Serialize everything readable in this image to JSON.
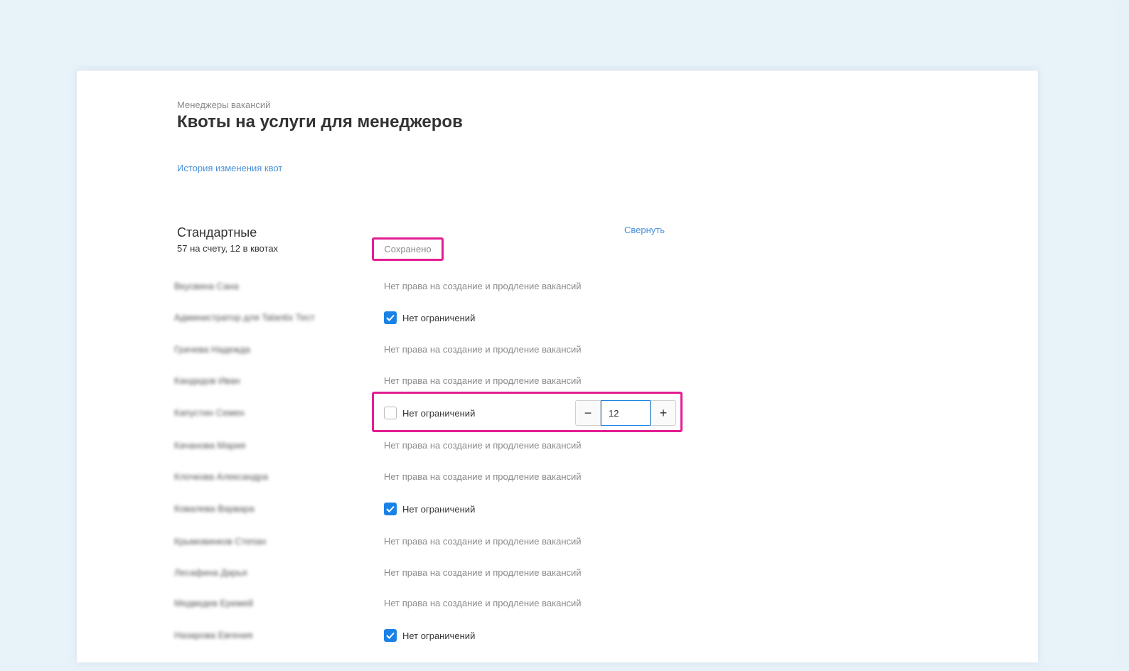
{
  "header": {
    "breadcrumb": "Менеджеры вакансий",
    "title": "Квоты на услуги для менеджеров",
    "history_link": "История изменения квот"
  },
  "section": {
    "title": "Стандартные",
    "subtitle": "57 на счету, 12 в квотах",
    "saved_status": "Сохранено",
    "collapse_label": "Свернуть"
  },
  "labels": {
    "no_rights": "Нет права на создание и продление вакансий",
    "unlimited": "Нет ограничений"
  },
  "managers": [
    {
      "name": "Вкусвина Сана",
      "state": "no_rights"
    },
    {
      "name": "Администратор для Talantix Тест",
      "state": "unlimited"
    },
    {
      "name": "Грачева Надежда",
      "state": "no_rights"
    },
    {
      "name": "Кандидов Иван",
      "state": "no_rights"
    },
    {
      "name": "Капустин Семен",
      "state": "limited",
      "quota": "12"
    },
    {
      "name": "Качанова Мария",
      "state": "no_rights"
    },
    {
      "name": "Клочкова Александра",
      "state": "no_rights"
    },
    {
      "name": "Ковалева Варвара",
      "state": "unlimited"
    },
    {
      "name": "Крымовинков Степан",
      "state": "no_rights"
    },
    {
      "name": "Лесафина Дарья",
      "state": "no_rights"
    },
    {
      "name": "Медведев Еремей",
      "state": "no_rights"
    },
    {
      "name": "Назарова Евгения",
      "state": "unlimited"
    }
  ],
  "stepper": {
    "minus": "−",
    "plus": "+",
    "value": "12"
  },
  "colors": {
    "accent": "#1a82e6",
    "link": "#4a90d9",
    "highlight": "#e31d93"
  }
}
